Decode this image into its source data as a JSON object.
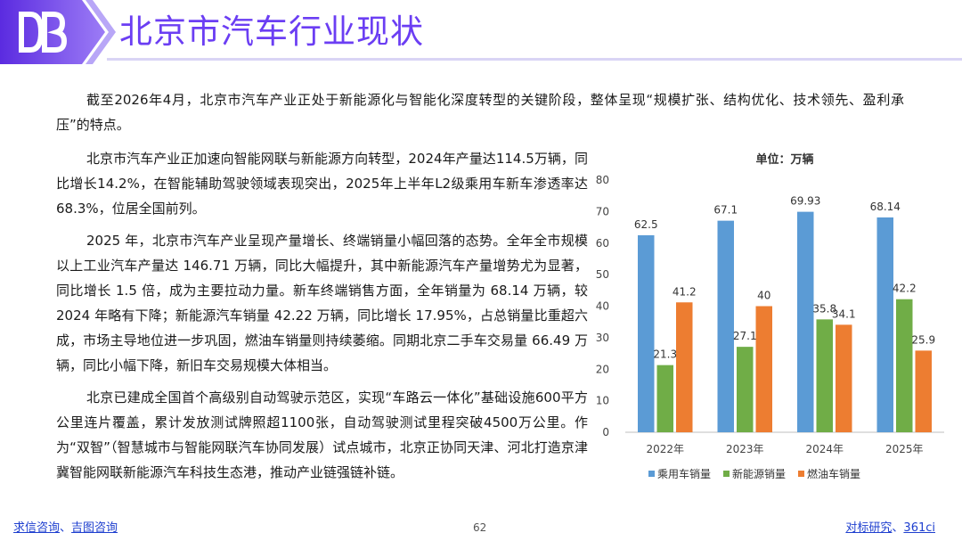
{
  "header": {
    "title": "北京市汽车行业现状",
    "brand_color": "#6b3ef3",
    "logo_icon": "db-logo-icon"
  },
  "body": {
    "paragraphs": [
      "截至2026年4月，北京市汽车产业正处于新能源化与智能化深度转型的关键阶段，整体呈现“规模扩张、结构优化、技术领先、盈利承压”的特点。",
      "北京市汽车产业正加速向智能网联与新能源方向转型，2024年产量达114.5万辆，同比增长14.2%，在智能辅助驾驶领域表现突出，2025年上半年L2级乘用车新车渗透率达68.3%，位居全国前列。",
      "2025 年，北京市汽车产业呈现产量增长、终端销量小幅回落的态势。全年全市规模以上工业汽车产量达 146.71 万辆，同比大幅提升，其中新能源汽车产量增势尤为显著，同比增长 1.5 倍，成为主要拉动力量。新车终端销售方面，全年销量为 68.14 万辆，较 2024 年略有下降；新能源汽车销量 42.22 万辆，同比增长 17.95%，占总销量比重超六成，市场主导地位进一步巩固，燃油车销量则持续萎缩。同期北京二手车交易量 66.49 万辆，同比小幅下降，新旧车交易规模大体相当。",
      "北京已建成全国首个高级别自动驾驶示范区，实现“车路云一体化”基础设施600平方公里连片覆盖，累计发放测试牌照超1100张，自动驾驶测试里程突破4500万公里。作为“双智”（智慧城市与智能网联汽车协同发展）试点城市，北京正协同天津、河北打造京津冀智能网联新能源汽车科技生态港，推动产业链强链补链。"
    ]
  },
  "chart_data": {
    "type": "bar",
    "title": "单位：万辆",
    "categories": [
      "2022年",
      "2023年",
      "2024年",
      "2025年"
    ],
    "series": [
      {
        "name": "乘用车销量",
        "values": [
          62.5,
          67.1,
          69.93,
          68.14
        ],
        "labels": [
          "62.5",
          "67.1",
          "69.93",
          "68.14"
        ],
        "color": "#5b9bd5"
      },
      {
        "name": "新能源销量",
        "values": [
          21.3,
          27.1,
          35.8,
          42.2
        ],
        "labels": [
          "21.3",
          "27.1",
          "35.8",
          "42.2"
        ],
        "color": "#70ad47"
      },
      {
        "name": "燃油车销量",
        "values": [
          41.2,
          40,
          34.1,
          25.9
        ],
        "labels": [
          "41.2",
          "40",
          "34.1",
          "25.9"
        ],
        "color": "#ed7d31"
      }
    ],
    "ylim": [
      0,
      80
    ],
    "yticks": [
      "0",
      "10",
      "20",
      "30",
      "40",
      "50",
      "60",
      "70",
      "80"
    ],
    "grid": false,
    "legend": "bottom"
  },
  "footer": {
    "left_links": [
      "求信咨询",
      "吉图咨询"
    ],
    "left_sep": "、",
    "page_number": "62",
    "right_links": [
      "对标研究",
      "361ci"
    ],
    "right_sep": "、"
  }
}
